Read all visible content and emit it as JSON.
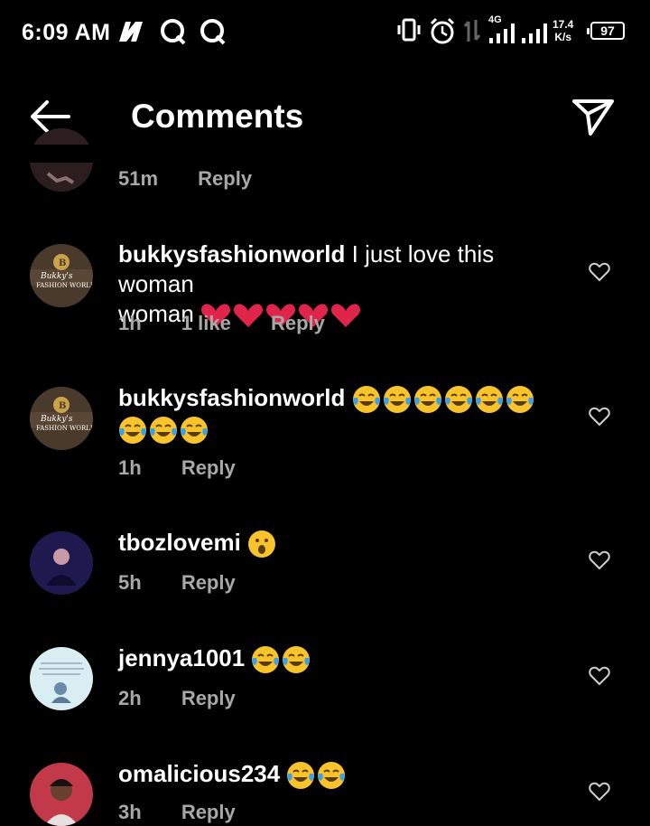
{
  "status_bar": {
    "time": "6:09 AM",
    "network": "4G",
    "speed_value": "17.4",
    "speed_unit": "K/s",
    "battery": "97"
  },
  "header": {
    "title": "Comments"
  },
  "partial_comment": {
    "time": "51m",
    "reply_label": "Reply"
  },
  "comments": [
    {
      "username": "bukkysfashionworld",
      "text": "I just love this woman",
      "emoji": [
        "heart",
        "heart",
        "heart",
        "heart",
        "heart"
      ],
      "time": "1h",
      "likes": "1 like",
      "reply_label": "Reply",
      "avatar_brand": "Bukky's",
      "avatar_sub": "FASHION WORLD"
    },
    {
      "username": "bukkysfashionworld",
      "text": "",
      "emoji": [
        "joy",
        "joy",
        "joy",
        "joy",
        "joy",
        "joy",
        "joy",
        "joy",
        "joy"
      ],
      "time": "1h",
      "reply_label": "Reply",
      "avatar_brand": "Bukky's",
      "avatar_sub": "FASHION WORLD"
    },
    {
      "username": "tbozlovemi",
      "text": "",
      "emoji": [
        "surprised"
      ],
      "time": "5h",
      "reply_label": "Reply"
    },
    {
      "username": "jennya1001",
      "text": "",
      "emoji": [
        "joy",
        "joy"
      ],
      "time": "2h",
      "reply_label": "Reply"
    },
    {
      "username": "omalicious234",
      "text": "",
      "emoji": [
        "joy",
        "joy"
      ],
      "time": "3h",
      "reply_label": "Reply"
    }
  ],
  "colors": {
    "background": "#000000",
    "meta_text": "#a8a8a8",
    "heart_emoji": "#e0244a",
    "joy_emoji": "#f8c32b"
  }
}
